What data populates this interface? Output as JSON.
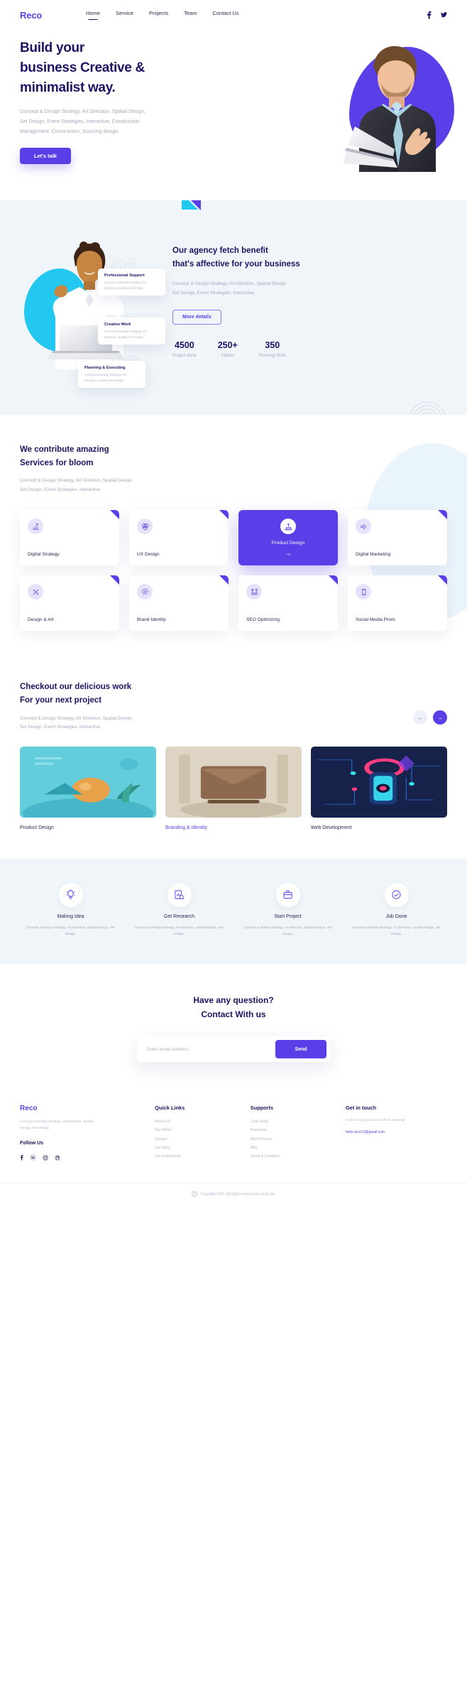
{
  "nav": {
    "logo": "Reco",
    "links": [
      {
        "label": "Home",
        "active": true
      },
      {
        "label": "Service",
        "active": false
      },
      {
        "label": "Projects",
        "active": false
      },
      {
        "label": "Team",
        "active": false
      },
      {
        "label": "Contact Us",
        "active": false
      }
    ],
    "social": [
      "facebook-icon",
      "twitter-icon"
    ]
  },
  "hero": {
    "title_line1": "Build your",
    "title_line2": "business Creative &",
    "title_line3": "minimalist way.",
    "paragraph_line1": "Concept & Design Strategy, Art Direction, Spatial Design,",
    "paragraph_line2": "Set Design, Event Strategies, Interactive, Construction",
    "paragraph_line3": "Management, Construction, Sourcing design.",
    "cta": "Let's talk"
  },
  "agency": {
    "title_line1": "Our agency fetch benefit",
    "title_line2": "that's affective for your business",
    "paragraph_line1": "Concept & Design Strategy, Art Direction, Spatial Design,",
    "paragraph_line2": "Set Design, Event Strategies, Interactive.",
    "cta": "More details",
    "ghost_numbers": [
      "01",
      "02",
      "03"
    ],
    "cards": [
      {
        "title": "Professional Support",
        "text": "Concept & Design Strategy, Art Direction, Spatial Set Design."
      },
      {
        "title": "Creative Work",
        "text": "Concept & Design Strategy, Art Direction, Spatial Set Design."
      },
      {
        "title": "Planning & Executing",
        "text": "Concept & Design Strategy, Art Direction, Spatial Set Design."
      }
    ],
    "stats": [
      {
        "value": "4500",
        "label": "Project done"
      },
      {
        "value": "250+",
        "label": "Clients"
      },
      {
        "value": "350",
        "label": "Running Work"
      }
    ]
  },
  "services": {
    "title_line1": "We contribute amazing",
    "title_line2": "Services for bloom",
    "paragraph_line1": "Concept & Design Strategy, Art Direction, Spatial Design,",
    "paragraph_line2": "Set Design, Event Strategies, Interactive.",
    "cards": [
      {
        "label": "Digital Strategy",
        "icon": "chart-bar-icon",
        "featured": false
      },
      {
        "label": "UX Design",
        "icon": "venn-circles-icon",
        "featured": false
      },
      {
        "label": "Product Design",
        "icon": "sitemap-icon",
        "featured": true,
        "arrow": "→"
      },
      {
        "label": "Digital Marketing",
        "icon": "megaphone-icon",
        "featured": false
      },
      {
        "label": "Design & Art",
        "icon": "pencil-ruler-icon",
        "featured": false
      },
      {
        "label": "Brand Identity",
        "icon": "fingerprint-icon",
        "featured": false
      },
      {
        "label": "SEO Optimizing",
        "icon": "network-nodes-icon",
        "featured": false
      },
      {
        "label": "Social Media Prom.",
        "icon": "mobile-share-icon",
        "featured": false
      }
    ]
  },
  "portfolio": {
    "title_line1": "Checkout our delicious work",
    "title_line2": "For your next project",
    "paragraph_line1": "Concept & Design Strategy, Art Direction, Spatial Design,",
    "paragraph_line2": "Set Design, Event Strategies, Interactive.",
    "prev": "←",
    "next": "→",
    "items": [
      {
        "title": "Product Design",
        "accent": false
      },
      {
        "title": "Branding & Identity",
        "accent": true
      },
      {
        "title": "Web Development",
        "accent": false
      }
    ]
  },
  "process": {
    "items": [
      {
        "title": "Making Idea",
        "icon": "lightbulb-icon",
        "text": "Concept & Design Strategy, Art Direction, Spatial Design, Set Design."
      },
      {
        "title": "Get Research",
        "icon": "report-search-icon",
        "text": "Concept & Design Strategy, Art Direction, Spatial Design, Set Design."
      },
      {
        "title": "Start Project",
        "icon": "briefcase-icon",
        "text": "Concept & Design Strategy, Art Direction, Spatial Design, Set Design."
      },
      {
        "title": "Job Done",
        "icon": "check-circle-icon",
        "text": "Concept & Design Strategy, Art Direction, Spatial Design, Set Design."
      }
    ]
  },
  "contact": {
    "title_line1": "Have any question?",
    "title_line2": "Contact With us",
    "placeholder": "Enter email address",
    "input_value": "",
    "send": "Send"
  },
  "footer": {
    "logo": "Reco",
    "about": "Concept & Design Strategy, Art Direction, Spatial Design, Set Design.",
    "follow_heading": "Follow Us",
    "social": [
      "facebook-icon",
      "behance-icon",
      "instagram-icon",
      "dribbble-icon"
    ],
    "quick_links": {
      "heading": "Quick Links",
      "items": [
        "About US",
        "Our Works",
        "Service",
        "Our Story",
        "Our Achievment"
      ]
    },
    "supports": {
      "heading": "Supports",
      "items": [
        "Case Study",
        "Resources",
        "Work Process",
        "FAQ",
        "Terms & Condition"
      ]
    },
    "get_in_touch": {
      "heading": "Get in touch",
      "text": "Feel free to get in touch with us via email",
      "email": "hello.reco12@gmail.com"
    },
    "copyright": "Copyright 2020. All rights reserved by durby Dic"
  },
  "colors": {
    "accent": "#5a3ee8",
    "navy": "#1b1464",
    "cyan": "#22c8f0",
    "muted": "#a6a8bd",
    "section_bg": "#f0f5f9"
  }
}
